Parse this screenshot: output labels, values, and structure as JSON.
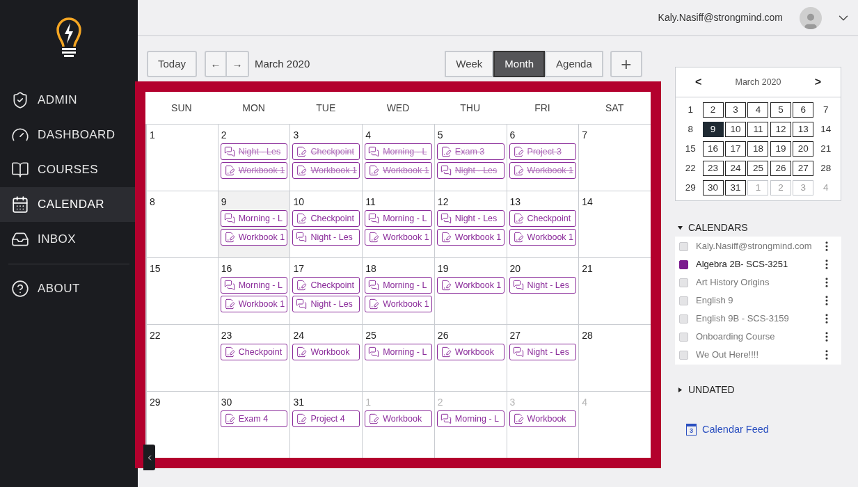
{
  "sidebar": {
    "items": [
      {
        "label": "ADMIN",
        "selected": false
      },
      {
        "label": "DASHBOARD",
        "selected": false
      },
      {
        "label": "COURSES",
        "selected": false
      },
      {
        "label": "CALENDAR",
        "selected": true
      },
      {
        "label": "INBOX",
        "selected": false
      }
    ],
    "footer_items": [
      {
        "label": "ABOUT",
        "selected": false
      }
    ]
  },
  "header": {
    "user_email": "Kaly.Nasiff@strongmind.com"
  },
  "toolbar": {
    "today": "Today",
    "prev": "←",
    "next": "→",
    "period": "March 2020",
    "views": [
      {
        "label": "Week",
        "selected": false
      },
      {
        "label": "Month",
        "selected": true
      },
      {
        "label": "Agenda",
        "selected": false
      }
    ],
    "add": "+"
  },
  "month": {
    "weekdays": [
      "SUN",
      "MON",
      "TUE",
      "WED",
      "THU",
      "FRI",
      "SAT"
    ],
    "weeks": [
      {
        "days": [
          {
            "day": "1",
            "outside": false,
            "today": false
          },
          {
            "day": "2",
            "outside": false,
            "today": false,
            "events": [
              {
                "kind": "chat",
                "title": "Night - Les",
                "done": true
              },
              {
                "kind": "doc",
                "title": "Workbook 1",
                "done": true
              }
            ]
          },
          {
            "day": "3",
            "outside": false,
            "today": false,
            "events": [
              {
                "kind": "doc",
                "title": "Checkpoint",
                "done": true
              },
              {
                "kind": "doc",
                "title": "Workbook 1",
                "done": true
              }
            ]
          },
          {
            "day": "4",
            "outside": false,
            "today": false,
            "events": [
              {
                "kind": "chat",
                "title": "Morning - L",
                "done": true
              },
              {
                "kind": "doc",
                "title": "Workbook 1",
                "done": true
              }
            ]
          },
          {
            "day": "5",
            "outside": false,
            "today": false,
            "events": [
              {
                "kind": "doc",
                "title": "Exam 3",
                "done": true
              },
              {
                "kind": "chat",
                "title": "Night - Les",
                "done": true
              }
            ]
          },
          {
            "day": "6",
            "outside": false,
            "today": false,
            "events": [
              {
                "kind": "doc",
                "title": "Project 3",
                "done": true
              },
              {
                "kind": "doc",
                "title": "Workbook 1",
                "done": true
              }
            ]
          },
          {
            "day": "7",
            "outside": false,
            "today": false
          }
        ]
      },
      {
        "days": [
          {
            "day": "8",
            "outside": false,
            "today": false
          },
          {
            "day": "9",
            "outside": false,
            "today": true,
            "events": [
              {
                "kind": "chat",
                "title": "Morning - L",
                "done": false
              },
              {
                "kind": "doc",
                "title": "Workbook 1",
                "done": false
              }
            ]
          },
          {
            "day": "10",
            "outside": false,
            "today": false,
            "events": [
              {
                "kind": "doc",
                "title": "Checkpoint",
                "done": false
              },
              {
                "kind": "chat",
                "title": "Night - Les",
                "done": false
              }
            ]
          },
          {
            "day": "11",
            "outside": false,
            "today": false,
            "events": [
              {
                "kind": "chat",
                "title": "Morning - L",
                "done": false
              },
              {
                "kind": "doc",
                "title": "Workbook 1",
                "done": false
              }
            ]
          },
          {
            "day": "12",
            "outside": false,
            "today": false,
            "events": [
              {
                "kind": "chat",
                "title": "Night - Les",
                "done": false
              },
              {
                "kind": "doc",
                "title": "Workbook 1",
                "done": false
              }
            ]
          },
          {
            "day": "13",
            "outside": false,
            "today": false,
            "events": [
              {
                "kind": "doc",
                "title": "Checkpoint",
                "done": false
              },
              {
                "kind": "doc",
                "title": "Workbook 1",
                "done": false
              }
            ]
          },
          {
            "day": "14",
            "outside": false,
            "today": false
          }
        ]
      },
      {
        "days": [
          {
            "day": "15",
            "outside": false,
            "today": false
          },
          {
            "day": "16",
            "outside": false,
            "today": false,
            "events": [
              {
                "kind": "chat",
                "title": "Morning - L",
                "done": false
              },
              {
                "kind": "doc",
                "title": "Workbook 1",
                "done": false
              }
            ]
          },
          {
            "day": "17",
            "outside": false,
            "today": false,
            "events": [
              {
                "kind": "doc",
                "title": "Checkpoint",
                "done": false
              },
              {
                "kind": "chat",
                "title": "Night - Les",
                "done": false
              }
            ]
          },
          {
            "day": "18",
            "outside": false,
            "today": false,
            "events": [
              {
                "kind": "chat",
                "title": "Morning - L",
                "done": false
              },
              {
                "kind": "doc",
                "title": "Workbook 1",
                "done": false
              }
            ]
          },
          {
            "day": "19",
            "outside": false,
            "today": false,
            "events": [
              {
                "kind": "doc",
                "title": "Workbook 1",
                "done": false
              }
            ]
          },
          {
            "day": "20",
            "outside": false,
            "today": false,
            "events": [
              {
                "kind": "chat",
                "title": "Night - Les",
                "done": false
              }
            ]
          },
          {
            "day": "21",
            "outside": false,
            "today": false
          }
        ]
      },
      {
        "days": [
          {
            "day": "22",
            "outside": false,
            "today": false
          },
          {
            "day": "23",
            "outside": false,
            "today": false,
            "events": [
              {
                "kind": "doc",
                "title": "Checkpoint",
                "done": false
              }
            ]
          },
          {
            "day": "24",
            "outside": false,
            "today": false,
            "events": [
              {
                "kind": "doc",
                "title": "Workbook",
                "done": false
              }
            ]
          },
          {
            "day": "25",
            "outside": false,
            "today": false,
            "events": [
              {
                "kind": "chat",
                "title": "Morning - L",
                "done": false
              }
            ]
          },
          {
            "day": "26",
            "outside": false,
            "today": false,
            "events": [
              {
                "kind": "doc",
                "title": "Workbook",
                "done": false
              }
            ]
          },
          {
            "day": "27",
            "outside": false,
            "today": false,
            "events": [
              {
                "kind": "chat",
                "title": "Night - Les",
                "done": false
              }
            ]
          },
          {
            "day": "28",
            "outside": false,
            "today": false
          }
        ]
      },
      {
        "days": [
          {
            "day": "29",
            "outside": false,
            "today": false
          },
          {
            "day": "30",
            "outside": false,
            "today": false,
            "events": [
              {
                "kind": "doc",
                "title": "Exam 4",
                "done": false
              }
            ]
          },
          {
            "day": "31",
            "outside": false,
            "today": false,
            "events": [
              {
                "kind": "doc",
                "title": "Project 4",
                "done": false
              }
            ]
          },
          {
            "day": "1",
            "outside": true,
            "today": false,
            "events": [
              {
                "kind": "doc",
                "title": "Workbook",
                "done": false
              }
            ]
          },
          {
            "day": "2",
            "outside": true,
            "today": false,
            "events": [
              {
                "kind": "chat",
                "title": "Morning - L",
                "done": false
              }
            ]
          },
          {
            "day": "3",
            "outside": true,
            "today": false,
            "events": [
              {
                "kind": "doc",
                "title": "Workbook",
                "done": false
              }
            ]
          },
          {
            "day": "4",
            "outside": true,
            "today": false
          }
        ]
      }
    ]
  },
  "mini_calendar": {
    "title": "March 2020",
    "prev": "<",
    "next": ">",
    "weeks": [
      [
        {
          "day": "1",
          "has_events": false,
          "selected": false,
          "outside": false
        },
        {
          "day": "2",
          "has_events": true,
          "selected": false,
          "outside": false
        },
        {
          "day": "3",
          "has_events": true,
          "selected": false,
          "outside": false
        },
        {
          "day": "4",
          "has_events": true,
          "selected": false,
          "outside": false
        },
        {
          "day": "5",
          "has_events": true,
          "selected": false,
          "outside": false
        },
        {
          "day": "6",
          "has_events": true,
          "selected": false,
          "outside": false
        },
        {
          "day": "7",
          "has_events": false,
          "selected": false,
          "outside": false
        }
      ],
      [
        {
          "day": "8",
          "has_events": false,
          "selected": false,
          "outside": false
        },
        {
          "day": "9",
          "selected": true
        },
        {
          "day": "10",
          "has_events": true,
          "selected": false,
          "outside": false
        },
        {
          "day": "11",
          "has_events": true,
          "selected": false,
          "outside": false
        },
        {
          "day": "12",
          "has_events": true,
          "selected": false,
          "outside": false
        },
        {
          "day": "13",
          "has_events": true,
          "selected": false,
          "outside": false
        },
        {
          "day": "14",
          "has_events": false,
          "selected": false,
          "outside": false
        }
      ],
      [
        {
          "day": "15",
          "has_events": false,
          "selected": false,
          "outside": false
        },
        {
          "day": "16",
          "has_events": true,
          "selected": false,
          "outside": false
        },
        {
          "day": "17",
          "has_events": true,
          "selected": false,
          "outside": false
        },
        {
          "day": "18",
          "has_events": true,
          "selected": false,
          "outside": false
        },
        {
          "day": "19",
          "has_events": true,
          "selected": false,
          "outside": false
        },
        {
          "day": "20",
          "has_events": true,
          "selected": false,
          "outside": false
        },
        {
          "day": "21",
          "has_events": false,
          "selected": false,
          "outside": false
        }
      ],
      [
        {
          "day": "22",
          "has_events": false,
          "selected": false,
          "outside": false
        },
        {
          "day": "23",
          "has_events": true,
          "selected": false,
          "outside": false
        },
        {
          "day": "24",
          "has_events": true,
          "selected": false,
          "outside": false
        },
        {
          "day": "25",
          "has_events": true,
          "selected": false,
          "outside": false
        },
        {
          "day": "26",
          "has_events": true,
          "selected": false,
          "outside": false
        },
        {
          "day": "27",
          "has_events": true,
          "selected": false,
          "outside": false
        },
        {
          "day": "28",
          "has_events": false,
          "selected": false,
          "outside": false
        }
      ],
      [
        {
          "day": "29",
          "has_events": false,
          "selected": false,
          "outside": false
        },
        {
          "day": "30",
          "has_events": true,
          "selected": false,
          "outside": false
        },
        {
          "day": "31",
          "has_events": true,
          "selected": false,
          "outside": false
        },
        {
          "day": "1",
          "has_events": true,
          "selected": false,
          "outside": true
        },
        {
          "day": "2",
          "has_events": true,
          "selected": false,
          "outside": true
        },
        {
          "day": "3",
          "has_events": true,
          "selected": false,
          "outside": true
        },
        {
          "day": "4",
          "has_events": false,
          "selected": false,
          "outside": true
        }
      ]
    ]
  },
  "calendars": {
    "title": "CALENDARS",
    "expanded": true,
    "items": [
      {
        "label": "Kaly.Nasiff@strongmind.com",
        "checked": false
      },
      {
        "label": "Algebra 2B- SCS-3251",
        "checked": true
      },
      {
        "label": "Art History Origins",
        "checked": false
      },
      {
        "label": "English 9",
        "checked": false
      },
      {
        "label": "English 9B - SCS-3159",
        "checked": false
      },
      {
        "label": "Onboarding Course",
        "checked": false
      },
      {
        "label": "We Out Here!!!!",
        "checked": false
      }
    ]
  },
  "undated": {
    "title": "UNDATED",
    "expanded": false
  },
  "calendar_feed": {
    "label": "Calendar Feed",
    "icon_text": "3"
  }
}
